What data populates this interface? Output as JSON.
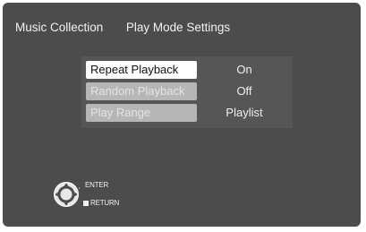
{
  "breadcrumb": {
    "section": "Music Collection",
    "page": "Play Mode Settings"
  },
  "settings": [
    {
      "label": "Repeat Playback",
      "value": "On",
      "selected": true
    },
    {
      "label": "Random Playback",
      "value": "Off",
      "selected": false
    },
    {
      "label": "Play Range",
      "value": "Playlist",
      "selected": false
    }
  ],
  "hints": {
    "enter_label": "ENTER",
    "return_label": "RETURN",
    "enter_icon": "dpad-enter-icon",
    "return_icon": "return-square-icon"
  },
  "colors": {
    "screen_background": "#4c4c4c",
    "selected_button": "#ffffff",
    "unselected_button": "#b6b6b6"
  }
}
